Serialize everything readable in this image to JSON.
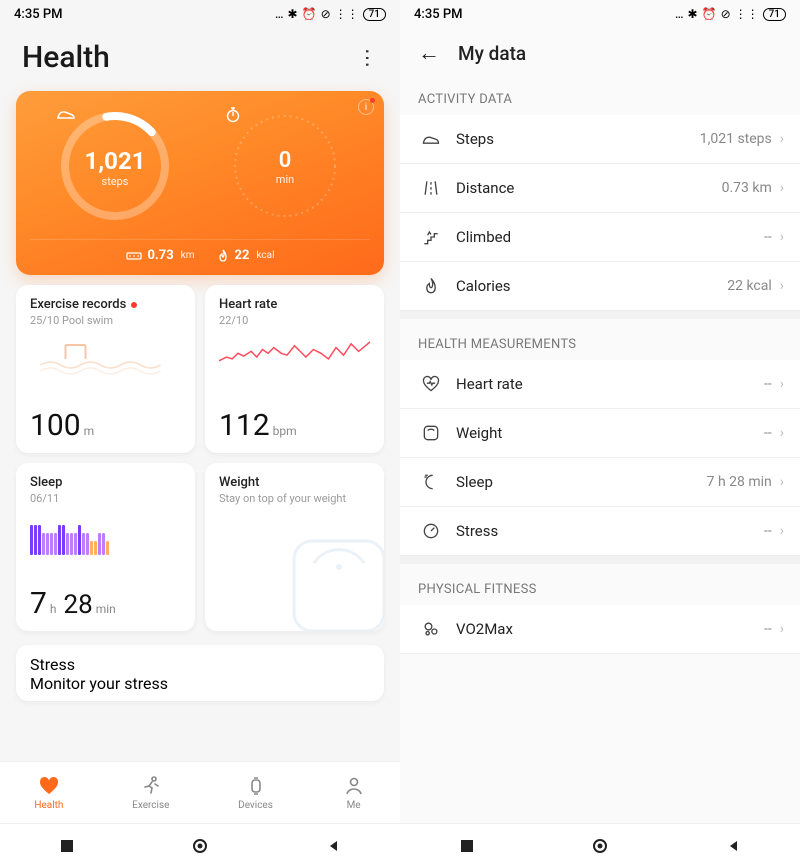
{
  "status": {
    "time": "4:35 PM",
    "battery": "71"
  },
  "left": {
    "title": "Health",
    "hero": {
      "steps_value": "1,021",
      "steps_label": "steps",
      "min_value": "0",
      "min_label": "min",
      "distance_value": "0.73",
      "distance_unit": "km",
      "calories_value": "22",
      "calories_unit": "kcal"
    },
    "cards": {
      "exercise": {
        "title": "Exercise records",
        "sub": "25/10 Pool swim",
        "value": "100",
        "unit": "m"
      },
      "heart": {
        "title": "Heart rate",
        "sub": "22/10",
        "value": "112",
        "unit": "bpm"
      },
      "sleep": {
        "title": "Sleep",
        "sub": "06/11",
        "value_h": "7",
        "unit_h": "h",
        "value_m": "28",
        "unit_m": "min"
      },
      "weight": {
        "title": "Weight",
        "sub": "Stay on top of your weight"
      },
      "stress": {
        "title": "Stress",
        "sub": "Monitor your stress"
      }
    },
    "tabs": [
      "Health",
      "Exercise",
      "Devices",
      "Me"
    ]
  },
  "right": {
    "title": "My data",
    "sections": {
      "activity": {
        "label": "ACTIVITY DATA",
        "steps": {
          "label": "Steps",
          "value": "1,021 steps"
        },
        "distance": {
          "label": "Distance",
          "value": "0.73 km"
        },
        "climbed": {
          "label": "Climbed",
          "value": "--"
        },
        "calories": {
          "label": "Calories",
          "value": "22 kcal"
        }
      },
      "health": {
        "label": "HEALTH MEASUREMENTS",
        "heart": {
          "label": "Heart rate",
          "value": "--"
        },
        "weight": {
          "label": "Weight",
          "value": "--"
        },
        "sleep": {
          "label": "Sleep",
          "value": "7 h 28 min"
        },
        "stress": {
          "label": "Stress",
          "value": "--"
        }
      },
      "fitness": {
        "label": "PHYSICAL FITNESS",
        "vo2": {
          "label": "VO2Max",
          "value": "--"
        }
      }
    }
  },
  "chart_data": {
    "type": "line",
    "title": "Heart rate",
    "series": [
      {
        "name": "bpm",
        "values": [
          98,
          102,
          100,
          106,
          103,
          108,
          104,
          110,
          107,
          112,
          106,
          109,
          104,
          108,
          103,
          114,
          108,
          118,
          112
        ]
      }
    ],
    "ylim": [
      90,
      125
    ]
  }
}
